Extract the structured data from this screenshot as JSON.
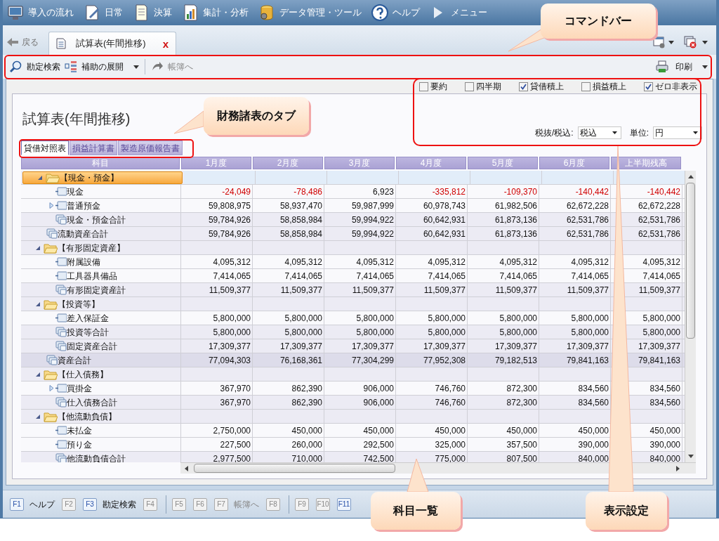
{
  "menubar": {
    "items": [
      {
        "label": "導入の流れ"
      },
      {
        "label": "日常"
      },
      {
        "label": "決算"
      },
      {
        "label": "集計・分析"
      },
      {
        "label": "データ管理・ツール"
      },
      {
        "label": "ヘルプ"
      },
      {
        "label": "メニュー"
      }
    ]
  },
  "nav": {
    "back": "戻る",
    "tab": {
      "label": "試算表(年間推移)",
      "close": "x"
    }
  },
  "command_bar": {
    "items": [
      {
        "label": "勘定検索",
        "disabled": false,
        "dropdown": false
      },
      {
        "label": "補助の展開",
        "disabled": false,
        "dropdown": true
      },
      {
        "label": "帳簿へ",
        "disabled": true,
        "dropdown": false
      }
    ],
    "print": {
      "label": "印刷"
    }
  },
  "options": {
    "checkboxes": [
      {
        "label": "要約",
        "checked": false
      },
      {
        "label": "四半期",
        "checked": false
      },
      {
        "label": "貸借積上",
        "checked": true
      },
      {
        "label": "損益積上",
        "checked": false
      },
      {
        "label": "ゼロ非表示",
        "checked": true
      }
    ],
    "tax": {
      "label": "税抜/税込:",
      "value": "税込"
    },
    "unit": {
      "label": "単位:",
      "value": "円"
    }
  },
  "title": "試算表(年間推移)",
  "tabs": [
    {
      "label": "貸借対照表",
      "selected": true
    },
    {
      "label": "損益計算書",
      "selected": false
    },
    {
      "label": "製造原価報告書",
      "selected": false
    }
  ],
  "grid": {
    "columns": [
      "科目",
      "1月度",
      "2月度",
      "3月度",
      "4月度",
      "5月度",
      "6月度",
      "上半期残高"
    ],
    "rows": [
      {
        "kind": "group",
        "label": "【現金・預金】",
        "expanded": true,
        "selected": true,
        "children": [
          {
            "kind": "leaf",
            "label": "現金",
            "expandable": false,
            "selected": false,
            "values": [
              "-24,049",
              "-78,486",
              "6,923",
              "-335,812",
              "-109,370",
              "-140,442",
              "-140,442"
            ],
            "red": [
              true,
              true,
              false,
              true,
              true,
              true,
              true
            ]
          },
          {
            "kind": "leaf",
            "label": "普通預金",
            "expandable": true,
            "selected": false,
            "values": [
              "59,808,975",
              "58,937,470",
              "59,987,999",
              "60,978,743",
              "61,982,506",
              "62,672,228",
              "62,672,228"
            ]
          },
          {
            "kind": "total",
            "label": "現金・預金合計",
            "selected": false,
            "values": [
              "59,784,926",
              "58,858,984",
              "59,994,922",
              "60,642,931",
              "61,873,136",
              "62,531,786",
              "62,531,786"
            ]
          }
        ]
      },
      {
        "kind": "total",
        "label": "流動資産合計",
        "selected": false,
        "values": [
          "59,784,926",
          "58,858,984",
          "59,994,922",
          "60,642,931",
          "61,873,136",
          "62,531,786",
          "62,531,786"
        ]
      },
      {
        "kind": "group",
        "label": "【有形固定資産】",
        "expanded": true,
        "selected": false,
        "children": [
          {
            "kind": "leaf",
            "label": "附属設備",
            "expandable": false,
            "selected": false,
            "values": [
              "4,095,312",
              "4,095,312",
              "4,095,312",
              "4,095,312",
              "4,095,312",
              "4,095,312",
              "4,095,312"
            ]
          },
          {
            "kind": "leaf",
            "label": "工具器具備品",
            "expandable": false,
            "selected": false,
            "values": [
              "7,414,065",
              "7,414,065",
              "7,414,065",
              "7,414,065",
              "7,414,065",
              "7,414,065",
              "7,414,065"
            ]
          },
          {
            "kind": "total",
            "label": "有形固定資産計",
            "selected": false,
            "values": [
              "11,509,377",
              "11,509,377",
              "11,509,377",
              "11,509,377",
              "11,509,377",
              "11,509,377",
              "11,509,377"
            ]
          }
        ]
      },
      {
        "kind": "group",
        "label": "【投資等】",
        "expanded": true,
        "selected": false,
        "children": [
          {
            "kind": "leaf",
            "label": "差入保証金",
            "expandable": false,
            "selected": false,
            "values": [
              "5,800,000",
              "5,800,000",
              "5,800,000",
              "5,800,000",
              "5,800,000",
              "5,800,000",
              "5,800,000"
            ]
          },
          {
            "kind": "total",
            "label": "投資等合計",
            "selected": false,
            "values": [
              "5,800,000",
              "5,800,000",
              "5,800,000",
              "5,800,000",
              "5,800,000",
              "5,800,000",
              "5,800,000"
            ]
          },
          {
            "kind": "total",
            "label": "固定資産合計",
            "selected": false,
            "values": [
              "17,309,377",
              "17,309,377",
              "17,309,377",
              "17,309,377",
              "17,309,377",
              "17,309,377",
              "17,309,377"
            ]
          }
        ]
      },
      {
        "kind": "grand_total",
        "label": "資産合計",
        "selected": false,
        "values": [
          "77,094,303",
          "76,168,361",
          "77,304,299",
          "77,952,308",
          "79,182,513",
          "79,841,163",
          "79,841,163"
        ]
      },
      {
        "kind": "group",
        "label": "【仕入債務】",
        "expanded": true,
        "selected": false,
        "children": [
          {
            "kind": "leaf",
            "label": "買掛金",
            "expandable": true,
            "selected": false,
            "values": [
              "367,970",
              "862,390",
              "906,000",
              "746,760",
              "872,300",
              "834,560",
              "834,560"
            ]
          },
          {
            "kind": "total",
            "label": "仕入債務合計",
            "selected": false,
            "values": [
              "367,970",
              "862,390",
              "906,000",
              "746,760",
              "872,300",
              "834,560",
              "834,560"
            ]
          }
        ]
      },
      {
        "kind": "group",
        "label": "【他流動負債】",
        "expanded": true,
        "selected": false,
        "children": [
          {
            "kind": "leaf",
            "label": "未払金",
            "expandable": false,
            "selected": false,
            "values": [
              "2,750,000",
              "450,000",
              "450,000",
              "450,000",
              "450,000",
              "450,000",
              "450,000"
            ]
          },
          {
            "kind": "leaf",
            "label": "預り金",
            "expandable": false,
            "selected": false,
            "values": [
              "227,500",
              "260,000",
              "292,500",
              "325,000",
              "357,500",
              "390,000",
              "390,000"
            ]
          },
          {
            "kind": "total",
            "label": "他流動負債合計",
            "selected": false,
            "values": [
              "2,977,500",
              "710,000",
              "742,500",
              "775,000",
              "807,500",
              "840,000",
              "840,000"
            ]
          }
        ]
      }
    ]
  },
  "function_keys": {
    "groups": [
      [
        {
          "key": "F1",
          "label": "ヘルプ",
          "enabled": true
        },
        {
          "key": "F2",
          "enabled": false
        },
        {
          "key": "F3",
          "label": "勘定検索",
          "enabled": true
        },
        {
          "key": "F4",
          "enabled": false
        }
      ],
      [
        {
          "key": "F5",
          "enabled": false
        },
        {
          "key": "F6",
          "enabled": false
        },
        {
          "key": "F7",
          "label": "帳簿へ",
          "enabled": false
        },
        {
          "key": "F8",
          "enabled": false
        }
      ],
      [
        {
          "key": "F9",
          "enabled": false
        },
        {
          "key": "F10",
          "enabled": false
        },
        {
          "key": "F11",
          "enabled": true
        }
      ]
    ]
  },
  "callouts": [
    {
      "text": "コマンドバー"
    },
    {
      "text": "財務諸表のタブ"
    },
    {
      "text": "科目一覧"
    },
    {
      "text": "表示設定"
    }
  ]
}
